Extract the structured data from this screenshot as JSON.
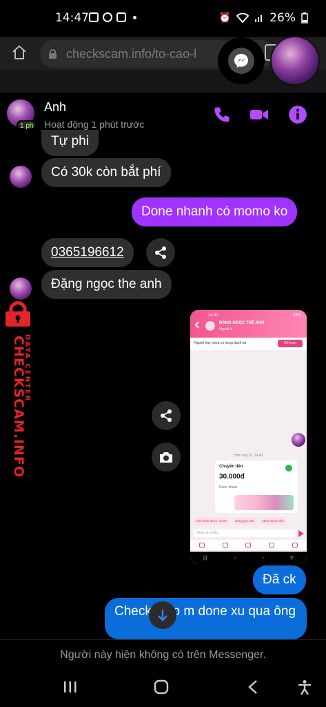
{
  "status_bar": {
    "time": "14:47",
    "battery": "26%"
  },
  "browser": {
    "url": "checkscam.info/to-cao-l"
  },
  "chat": {
    "name": "Anh",
    "status": "Hoạt động 1 phút trước",
    "active_badge": "1 ph",
    "messages": [
      {
        "dir": "in",
        "text": "Tự phi"
      },
      {
        "dir": "in",
        "text": "Có  30k còn bắt phí"
      },
      {
        "dir": "out",
        "text": "Done nhanh có momo ko"
      },
      {
        "dir": "in",
        "text": "0365196612"
      },
      {
        "dir": "in",
        "text": "Đặng ngọc the anh"
      },
      {
        "dir": "out",
        "text": "Đã ck"
      },
      {
        "dir": "out",
        "text": "Check giúp m done xu qua ông"
      }
    ],
    "footer_note": "Người này hiện không có trên Messenger."
  },
  "shared_screenshot": {
    "status_time": "14:42",
    "status_battery": "28%",
    "contact_name": "ĐẶNG NGỌC THẾ ANH",
    "contact_sub": "Người lạ",
    "notice": "Người này chưa có trong danh bạ",
    "add_friend": "Kết bạn",
    "time_divider": "Hôm nay 01, 14:42",
    "transfer_title": "Chuyển tiền",
    "transfer_amount": "30.000đ",
    "transfer_note": "Done 3mau",
    "chips": [
      "Anh nhận được chưa?",
      "Đúng giờ nhé",
      "Nhận được tiền"
    ],
    "input_placeholder": "Nhập tin nhắn"
  },
  "watermark": {
    "main": "CHECKSCAM.INFO",
    "sub": "DATA CENTER"
  },
  "colors": {
    "accent_purple": "#a033ff",
    "outgoing_blue": "#0b6dd9",
    "watermark_red": "#e3242b"
  }
}
